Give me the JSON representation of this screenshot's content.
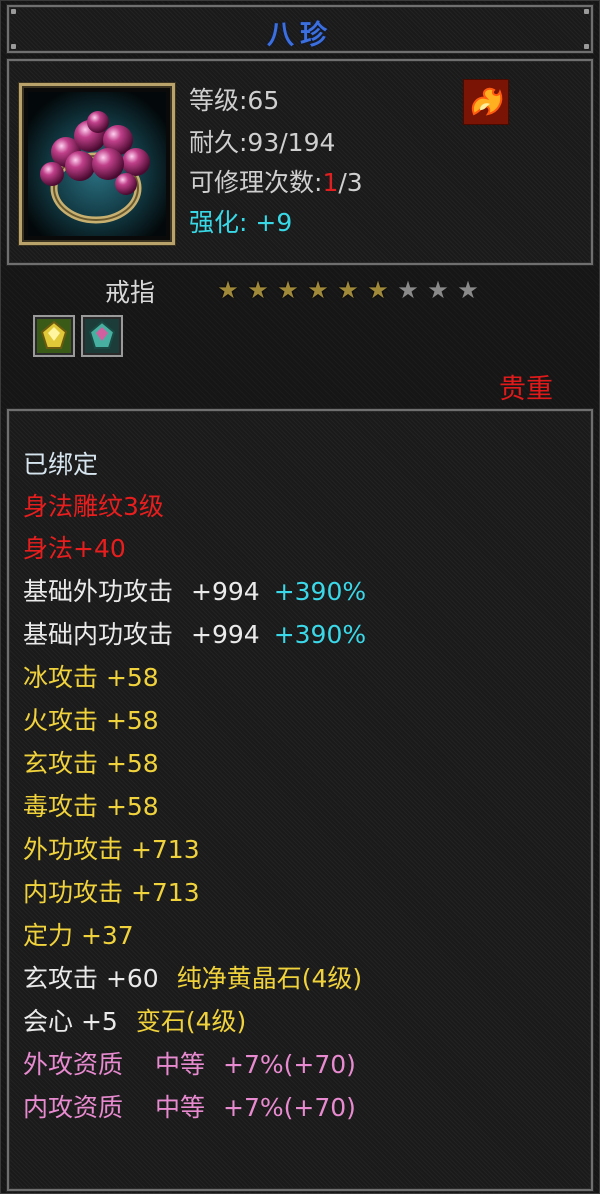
{
  "item": {
    "name": "八珍",
    "level_line": "等级:65",
    "durability_line": "耐久:93/194",
    "repair_label": "可修理次数:",
    "repair_used": "1",
    "repair_total": "/3",
    "enhance_line": "强化: +9",
    "type": "戒指",
    "stars_lit": 6,
    "stars_total": 9,
    "rarity": "贵重"
  },
  "stats": {
    "bound": "已绑定",
    "engrave": "身法雕纹3级",
    "agility": "身法+40",
    "base_outer_label": "基础外功攻击",
    "base_outer_value": "+994",
    "base_outer_pct": "+390%",
    "base_inner_label": "基础内功攻击",
    "base_inner_value": "+994",
    "base_inner_pct": "+390%",
    "ice": "冰攻击 +58",
    "fire": "火攻击 +58",
    "xuan": "玄攻击 +58",
    "poison": "毒攻击 +58",
    "outer_atk": "外功攻击 +713",
    "inner_atk": "内功攻击 +713",
    "focus": "定力 +37",
    "gem1_stat": "玄攻击 +60",
    "gem1_name": "纯净黄晶石(4级)",
    "gem2_stat": "会心 +5",
    "gem2_name": "变石(4级)",
    "apt_outer_label": "外攻资质",
    "apt_outer_grade": "中等",
    "apt_outer_value": "+7%(+70)",
    "apt_inner_label": "内攻资质",
    "apt_inner_grade": "中等",
    "apt_inner_value": "+7%(+70)"
  },
  "colors": {
    "title": "#3b6fe0",
    "red": "#e81e1e",
    "cyan": "#3ad8e8",
    "gold": "#d8c8a0",
    "yellow": "#f0d23c",
    "pink": "#e88ad0"
  },
  "icons": {
    "item": "ring-icon",
    "element": "fire-icon",
    "gem_slot_1": "yellow-gem-icon",
    "gem_slot_2": "teal-gem-icon"
  }
}
